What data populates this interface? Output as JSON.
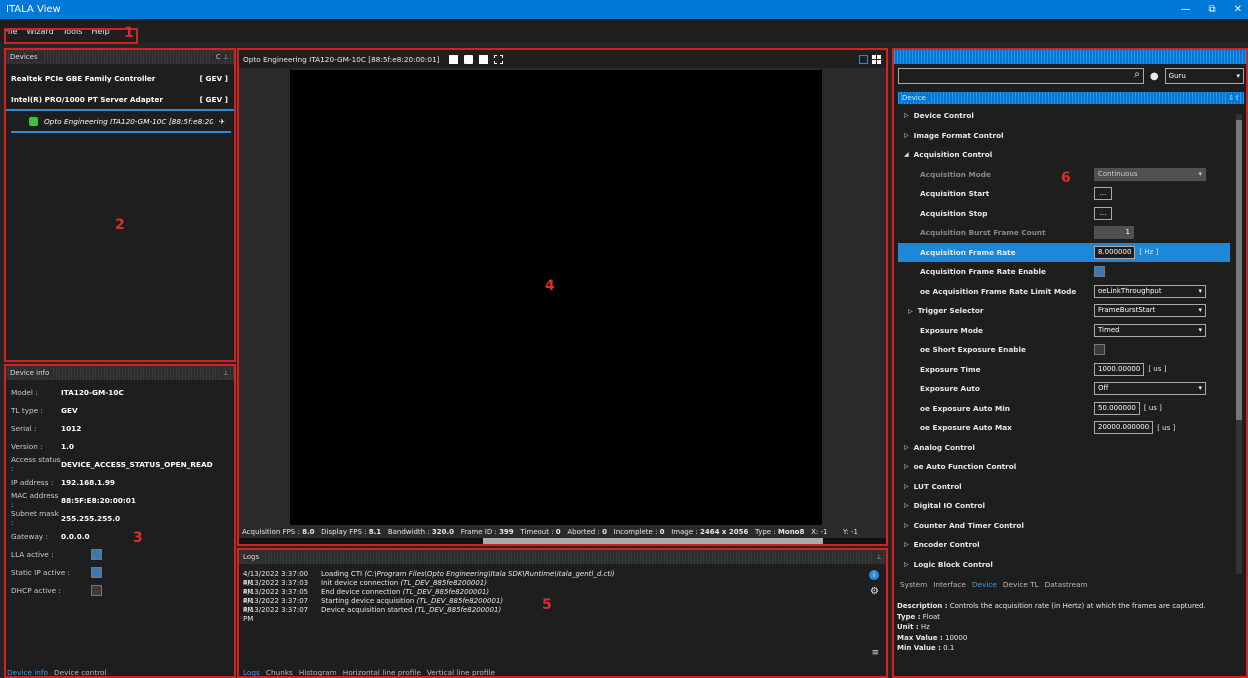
{
  "window": {
    "title": "ITALA View",
    "controls": [
      "—",
      "⧉",
      "✕"
    ]
  },
  "menu": [
    "File",
    "Wizard",
    "Tools",
    "Help"
  ],
  "annotations": [
    "1",
    "2",
    "3",
    "4",
    "5",
    "6"
  ],
  "devices_panel": {
    "title": "Devices",
    "refresh": "C",
    "pin": "⊥",
    "interfaces": [
      {
        "name": "Realtek PCIe GBE Family Controller",
        "tag": "[ GEV ]"
      },
      {
        "name": "Intel(R) PRO/1000 PT Server Adapter",
        "tag": "[ GEV ]"
      }
    ],
    "camera": "Opto Engineering ITA120-GM-10C [88:5f:e8:20"
  },
  "device_info": {
    "title": "Device info",
    "pin": "⊥",
    "rows": [
      {
        "k": "Model :",
        "v": "ITA120-GM-10C"
      },
      {
        "k": "TL type :",
        "v": "GEV"
      },
      {
        "k": "Serial :",
        "v": "1012"
      },
      {
        "k": "Version :",
        "v": "1.0"
      },
      {
        "k": "Access status :",
        "v": "DEVICE_ACCESS_STATUS_OPEN_READ"
      },
      {
        "k": "IP address :",
        "v": "192.168.1.99"
      },
      {
        "k": "MAC address :",
        "v": "88:5F:E8:20:00:01"
      },
      {
        "k": "Subnet mask :",
        "v": "255.255.255.0"
      },
      {
        "k": "Gateway :",
        "v": "0.0.0.0"
      }
    ],
    "checks": [
      {
        "k": "LLA active :",
        "on": true
      },
      {
        "k": "Static IP active :",
        "on": true
      },
      {
        "k": "DHCP active :",
        "on": false
      }
    ],
    "tabs": [
      "Device info",
      "Device control"
    ]
  },
  "viewer": {
    "title": "Opto Engineering ITA120-GM-10C [88:5f:e8:20:00:01]",
    "status": {
      "acq_fps_l": "Acquisition FPS :",
      "acq_fps": "8.0",
      "disp_fps_l": "Display FPS :",
      "disp_fps": "8.1",
      "bw_l": "Bandwidth :",
      "bw": "320.0",
      "fid_l": "Frame ID :",
      "fid": "399",
      "to_l": "Timeout :",
      "to": "0",
      "ab_l": "Aborted :",
      "ab": "0",
      "inc_l": "Incomplete :",
      "inc": "0",
      "img_l": "Image :",
      "img": "2464 x 2056",
      "type_l": "Type :",
      "type": "Mono8",
      "x": "X: -1",
      "y": "Y: -1"
    }
  },
  "logs": {
    "title": "Logs",
    "pin": "⊥",
    "lines": [
      {
        "t": "4/13/2022 3:37:00 PM",
        "m": "Loading CTI",
        "d": "(C:\\Program Files\\Opto Engineering\\Itala SDK\\Runtime\\itala_gentl_d.cti)"
      },
      {
        "t": "4/13/2022 3:37:03 PM",
        "m": "Init device connection",
        "d": "(TL_DEV_885fe8200001)"
      },
      {
        "t": "4/13/2022 3:37:05 PM",
        "m": "End device connection",
        "d": "(TL_DEV_885fe8200001)"
      },
      {
        "t": "4/13/2022 3:37:07 PM",
        "m": "Starting device acquisition",
        "d": "(TL_DEV_885fe8200001)"
      },
      {
        "t": "4/13/2022 3:37:07 PM",
        "m": "Device acquisition started",
        "d": "(TL_DEV_885fe8200001)"
      }
    ],
    "tabs": [
      "Logs",
      "Chunks",
      "Histogram",
      "Horizontal line profile",
      "Vertical line profile"
    ]
  },
  "props": {
    "search_placeholder": "",
    "level": "Guru",
    "section": "Device",
    "categories_top": [
      "Device Control",
      "Image Format Control"
    ],
    "open_cat": "Acquisition Control",
    "rows": [
      {
        "n": "Acquisition Mode",
        "kind": "ddl",
        "v": "Continuous",
        "dim": true,
        "disabled": true
      },
      {
        "n": "Acquisition Start",
        "kind": "btn",
        "v": "..."
      },
      {
        "n": "Acquisition Stop",
        "kind": "btn",
        "v": "..."
      },
      {
        "n": "Acquisition Burst Frame Count",
        "kind": "num",
        "v": "1",
        "dim": true
      },
      {
        "n": "Acquisition Frame Rate",
        "kind": "val",
        "v": "8.000000",
        "u": "[ Hz ]",
        "sel": true
      },
      {
        "n": "Acquisition Frame Rate Enable",
        "kind": "chk",
        "on": true
      },
      {
        "n": "oe Acquisition Frame Rate Limit Mode",
        "kind": "ddl",
        "v": "oeLinkThroughput"
      },
      {
        "n": "Trigger Selector",
        "kind": "ddl",
        "v": "FrameBurstStart",
        "exp": true
      },
      {
        "n": "Exposure Mode",
        "kind": "ddl",
        "v": "Timed"
      },
      {
        "n": "oe Short Exposure Enable",
        "kind": "chk",
        "on": false
      },
      {
        "n": "Exposure Time",
        "kind": "val",
        "v": "1000.00000",
        "u": "[ us ]"
      },
      {
        "n": "Exposure Auto",
        "kind": "ddl",
        "v": "Off"
      },
      {
        "n": "oe Exposure Auto Min",
        "kind": "val",
        "v": "50.000000",
        "u": "[ us ]"
      },
      {
        "n": "oe Exposure Auto Max",
        "kind": "val",
        "v": "20000.000000",
        "u": "[ us ]"
      }
    ],
    "categories_bottom": [
      "Analog Control",
      "oe Auto Function Control",
      "LUT Control",
      "Digital IO Control",
      "Counter And Timer Control",
      "Encoder Control",
      "Logic Block Control"
    ],
    "tabs": [
      "System",
      "Interface",
      "Device",
      "Device TL",
      "Datastream"
    ],
    "desc": [
      {
        "k": "Description :",
        "v": "Controls the acquisition rate (in Hertz) at which the frames are captured."
      },
      {
        "k": "Type :",
        "v": "Float"
      },
      {
        "k": "Unit :",
        "v": "Hz"
      },
      {
        "k": "Max Value :",
        "v": "10000"
      },
      {
        "k": "Min Value :",
        "v": "0.1"
      }
    ]
  },
  "colors": {
    "accent": "#0078d7",
    "annotation": "#d42121"
  }
}
